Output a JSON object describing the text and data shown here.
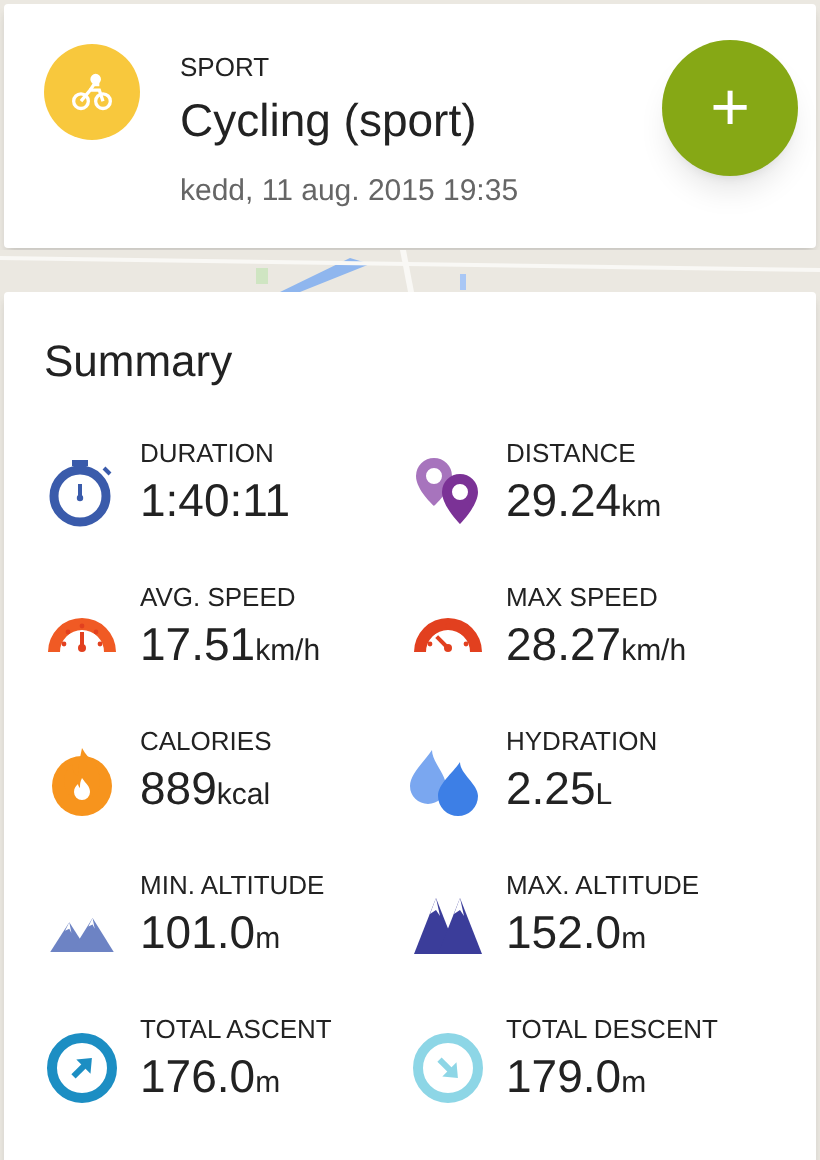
{
  "activity": {
    "category": "SPORT",
    "name": "Cycling (sport)",
    "datetime": "kedd, 11 aug. 2015 19:35",
    "action": "+"
  },
  "summary": {
    "title": "Summary",
    "stats": [
      {
        "kind": "duration",
        "label": "DURATION",
        "value": "1:40:11"
      },
      {
        "kind": "distance",
        "label": "DISTANCE",
        "value": "29.24",
        "unit": "km"
      },
      {
        "kind": "avg-speed",
        "label": "AVG. SPEED",
        "value": "17.51",
        "unit": "km/h"
      },
      {
        "kind": "max-speed",
        "label": "MAX SPEED",
        "value": "28.27",
        "unit": "km/h"
      },
      {
        "kind": "calories",
        "label": "CALORIES",
        "value": "889",
        "unit": "kcal"
      },
      {
        "kind": "hydration",
        "label": "HYDRATION",
        "value": "2.25",
        "unit": "L"
      },
      {
        "kind": "min-altitude",
        "label": "MIN. ALTITUDE",
        "value": "101.0",
        "unit": "m"
      },
      {
        "kind": "max-altitude",
        "label": "MAX. ALTITUDE",
        "value": "152.0",
        "unit": "m"
      },
      {
        "kind": "ascent",
        "label": "TOTAL ASCENT",
        "value": "176.0",
        "unit": "m"
      },
      {
        "kind": "descent",
        "label": "TOTAL DESCENT",
        "value": "179.0",
        "unit": "m"
      }
    ]
  }
}
